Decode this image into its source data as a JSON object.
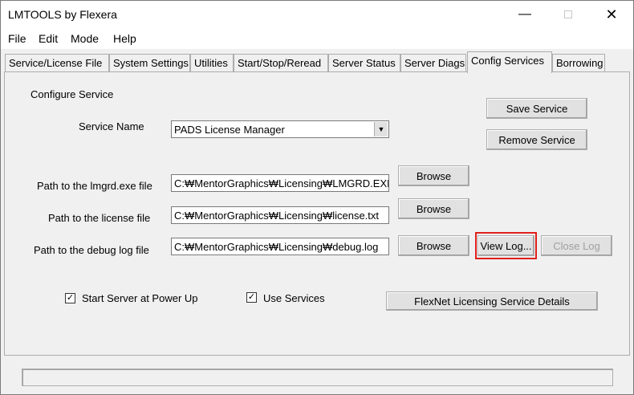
{
  "window": {
    "title": "LMTOOLS by Flexera",
    "minimize_icon": "minimize-icon",
    "maximize_icon": "maximize-icon",
    "close_icon": "close-icon"
  },
  "menu": [
    "File",
    "Edit",
    "Mode",
    "Help"
  ],
  "tabs": [
    "Service/License File",
    "System Settings",
    "Utilities",
    "Start/Stop/Reread",
    "Server Status",
    "Server Diags",
    "Config Services",
    "Borrowing"
  ],
  "active_tab": "Config Services",
  "config": {
    "section_label": "Configure Service",
    "service_name_label": "Service Name",
    "service_name_value": "PADS License Manager",
    "lmgrd_label": "Path to the lmgrd.exe file",
    "lmgrd_value": "C:₩MentorGraphics₩Licensing₩LMGRD.EXE",
    "license_label": "Path to the license file",
    "license_value": "C:₩MentorGraphics₩Licensing₩license.txt",
    "debug_label": "Path to the debug log file",
    "debug_value": "C:₩MentorGraphics₩Licensing₩debug.log",
    "browse_label": "Browse",
    "save_service": "Save Service",
    "remove_service": "Remove Service",
    "view_log": "View Log...",
    "close_log": "Close Log",
    "start_at_powerup": "Start Server at Power Up",
    "start_at_powerup_checked": true,
    "use_services": "Use Services",
    "use_services_checked": true,
    "flexnet_details": "FlexNet Licensing Service Details"
  },
  "colors": {
    "highlight": "#e0201b"
  }
}
